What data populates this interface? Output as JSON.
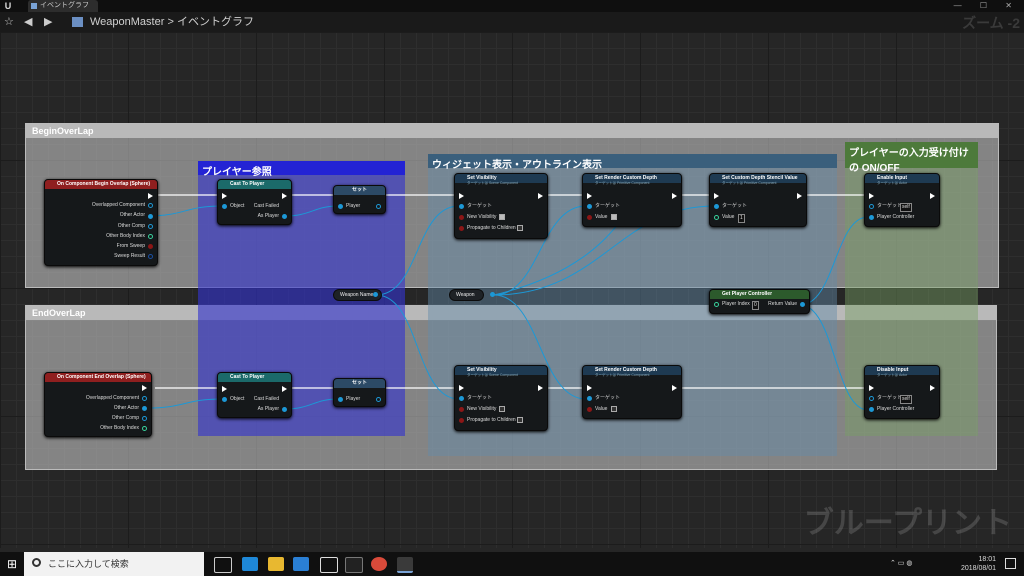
{
  "titlebar": {
    "tab_label": "イベントグラフ",
    "window_controls": "— ☐ ✕"
  },
  "toolbar": {
    "breadcrumb_root": "WeaponMaster",
    "breadcrumb_sep": ">",
    "breadcrumb_current": "イベントグラフ",
    "zoom": "ズーム -2"
  },
  "sections": {
    "begin": "BeginOverLap",
    "end": "EndOverLap"
  },
  "groups": {
    "player_ref": "プレイヤー参照",
    "widget": "ウィジェット表示・アウトライン表示",
    "input": "プレイヤーの入力受け付けの ON/OFF"
  },
  "nodes": {
    "begin_event": {
      "title": "On Component Begin Overlap (Sphere)",
      "pins": [
        "Overlapped Component",
        "Other Actor",
        "Other Comp",
        "Other Body Index",
        "From Sweep",
        "Sweep Result"
      ]
    },
    "end_event": {
      "title": "On Component End Overlap (Sphere)",
      "pins": [
        "Overlapped Component",
        "Other Actor",
        "Other Comp",
        "Other Body Index"
      ]
    },
    "cast": {
      "title": "Cast To Player",
      "object": "Object",
      "failed": "Cast Failed",
      "as_player": "As Player"
    },
    "set": {
      "title": "セット",
      "player": "Player"
    },
    "weapon_name": "Weapon Name",
    "weapon": "Weapon",
    "set_visibility": {
      "title": "Set Visibility",
      "subtitle": "ターゲットは Scene Component",
      "target": "ターゲット",
      "new_vis": "New Visibility",
      "propagate": "Propagate to Children"
    },
    "render_depth": {
      "title": "Set Render Custom Depth",
      "subtitle": "ターゲットは Primitive Component",
      "target": "ターゲット",
      "value": "Value"
    },
    "stencil": {
      "title": "Set Custom Depth Stencil Value",
      "subtitle": "ターゲットは Primitive Component",
      "target": "ターゲット",
      "value": "Value",
      "value_num": "1"
    },
    "get_pc": {
      "title": "Get Player Controller",
      "index": "Player Index",
      "index_num": "0",
      "ret": "Return Value"
    },
    "enable_input": {
      "title": "Enable Input",
      "subtitle": "ターゲットは Actor",
      "target": "ターゲット",
      "self": "self",
      "pc": "Player Controller"
    },
    "disable_input": {
      "title": "Disable Input",
      "subtitle": "ターゲットは Actor",
      "target": "ターゲット",
      "self": "self",
      "pc": "Player Controller"
    }
  },
  "watermark": "ブループリント",
  "taskbar": {
    "search_placeholder": "ここに入力して検索",
    "time": "18:01",
    "date": "2018/08/01"
  }
}
